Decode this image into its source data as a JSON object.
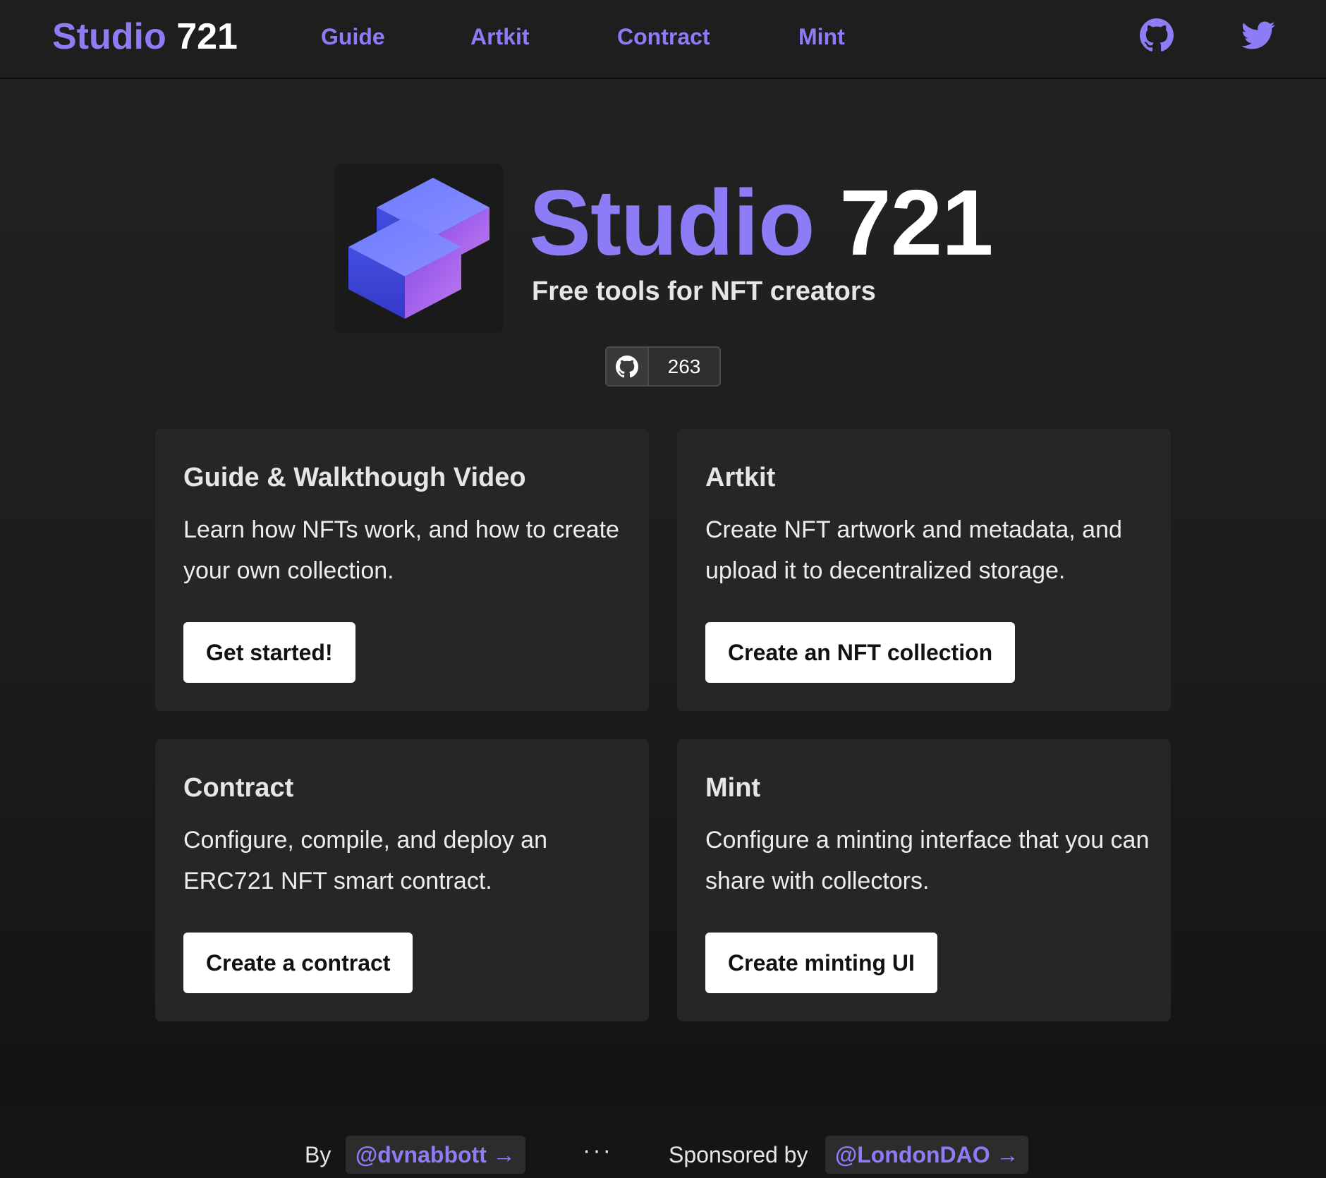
{
  "brand": {
    "part1": "Studio",
    "part2": "721"
  },
  "nav": {
    "guide": "Guide",
    "artkit": "Artkit",
    "contract": "Contract",
    "mint": "Mint",
    "icons": [
      "github-icon",
      "twitter-icon"
    ]
  },
  "hero": {
    "title_part1": "Studio",
    "title_part2": "721",
    "subtitle": "Free tools for NFT creators",
    "github_stars": "263"
  },
  "cards": [
    {
      "title": "Guide & Walkthough Video",
      "description": "Learn how NFTs work, and how to create your own collection.",
      "button": "Get started!"
    },
    {
      "title": "Artkit",
      "description": "Create NFT artwork and metadata, and upload it to decentralized storage.",
      "button": "Create an NFT collection"
    },
    {
      "title": "Contract",
      "description": "Configure, compile, and deploy an ERC721 NFT smart contract.",
      "button": "Create a contract"
    },
    {
      "title": "Mint",
      "description": "Configure a minting interface that you can share with collectors.",
      "button": "Create minting UI"
    }
  ],
  "footer": {
    "by": "By",
    "author": "@dvnabbott →",
    "separator": "···",
    "sponsored_by": "Sponsored by",
    "sponsor": "@LondonDAO →"
  },
  "colors": {
    "accent": "#8c7cf6",
    "background": "#1c1c1c",
    "card": "#262626",
    "button": "#ffffff"
  }
}
